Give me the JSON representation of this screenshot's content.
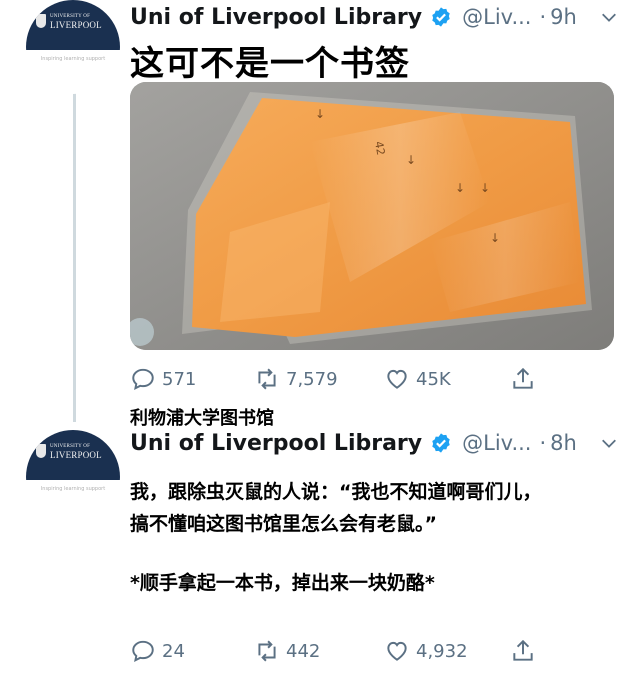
{
  "tweets": [
    {
      "author_name": "Uni of Liverpool Library",
      "handle": "@Liv...",
      "time": "9h",
      "avatar": {
        "university_line1": "UNIVERSITY OF",
        "university_line2": "LIVERPOOL",
        "tagline": "Inspiring learning support"
      },
      "caption": "这可不是一个书签",
      "stats": {
        "replies": "571",
        "retweets": "7,579",
        "likes": "45K"
      }
    },
    {
      "author_name": "Uni of Liverpool Library",
      "handle": "@Liv...",
      "time": "8h",
      "avatar": {
        "university_line1": "UNIVERSITY OF",
        "university_line2": "LIVERPOOL",
        "tagline": "Inspiring learning support"
      },
      "body_line1": "我，跟除虫灭鼠的人说：“我也不知道啊哥们儿，",
      "body_line2": "搞不懂咱这图书馆里怎么会有老鼠。”",
      "body_line3": "*顺手拿起一本书，掉出来一块奶酪*",
      "stats": {
        "replies": "24",
        "retweets": "442",
        "likes": "4,932"
      }
    }
  ],
  "overlay_label": "利物浦大学图书馆",
  "colors": {
    "verified": "#1da1f2",
    "muted": "#5b7083",
    "avatar_band": "#1a3050",
    "cheese": "#f2a04a"
  },
  "icons": [
    "verified-badge-icon",
    "chevron-down-icon",
    "reply-icon",
    "retweet-icon",
    "like-icon",
    "share-icon"
  ]
}
